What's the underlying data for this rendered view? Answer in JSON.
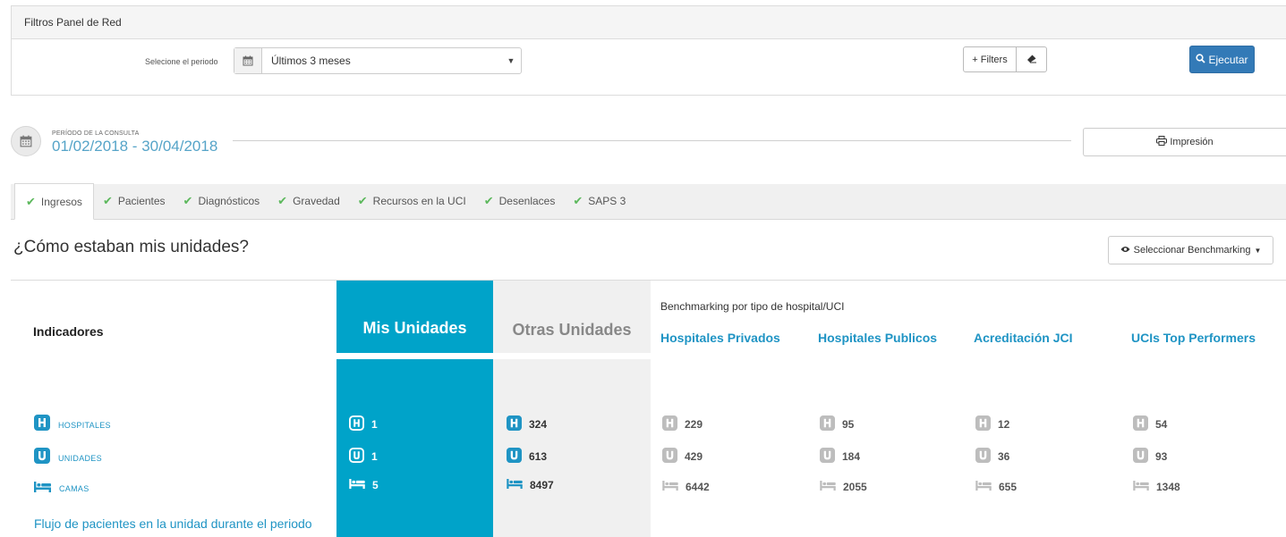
{
  "filter_panel": {
    "title": "Filtros Panel de Red",
    "period_label": "Selecione el periodo",
    "period_value": "Últimos 3 meses",
    "filters_btn": "+ Filters",
    "run_btn": "Ejecutar"
  },
  "consult": {
    "label": "PERÍODO DE LA CONSULTA",
    "dates": "01/02/2018 - 30/04/2018",
    "print_btn": "Impresión"
  },
  "tabs": [
    "Ingresos",
    "Pacientes",
    "Diagnósticos",
    "Gravedad",
    "Recursos en la UCI",
    "Desenlaces",
    "SAPS 3"
  ],
  "section": {
    "title": "¿Cómo estaban mis unidades?",
    "bench_btn": "Seleccionar Benchmarking"
  },
  "table": {
    "indicators_header": "Indicadores",
    "mis_header": "Mis Unidades",
    "otras_header": "Otras Unidades",
    "bench_subtitle": "Benchmarking por tipo de hospital/UCI",
    "bench_headers": [
      "Hospitales Privados",
      "Hospitales Publicos",
      "Acreditación JCI",
      "UCIs Top Performers"
    ],
    "rows": [
      {
        "label": "HOSPITALES",
        "mis": "1",
        "otras": "324",
        "bench": [
          "229",
          "95",
          "12",
          "54"
        ]
      },
      {
        "label": "UNIDADES",
        "mis": "1",
        "otras": "613",
        "bench": [
          "429",
          "184",
          "36",
          "93"
        ]
      },
      {
        "label": "CAMAS",
        "mis": "5",
        "otras": "8497",
        "bench": [
          "6442",
          "2055",
          "655",
          "1348"
        ]
      }
    ],
    "flujo_link": "Flujo de pacientes en la unidad durante el periodo"
  },
  "colors": {
    "accent": "#00a3c9",
    "link": "#1f94c4",
    "primary_btn": "#337ab7",
    "check": "#5cb85c"
  }
}
